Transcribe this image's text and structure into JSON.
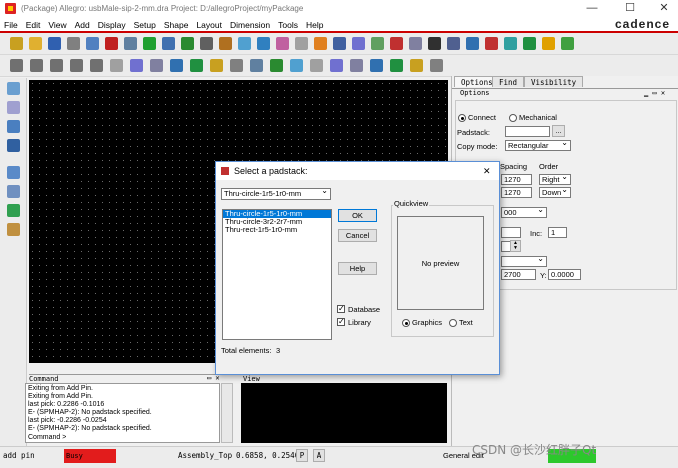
{
  "window": {
    "title": "(Package) Allegro: usbMale-sip-2-mm.dra  Project: D:/allegroProject/myPackage",
    "minimize": "—",
    "maximize": "☐",
    "close": "✕"
  },
  "brand": "cadence",
  "menu": [
    "File",
    "Edit",
    "View",
    "Add",
    "Display",
    "Setup",
    "Shape",
    "Layout",
    "Dimension",
    "Tools",
    "Help"
  ],
  "toolbar_colors": [
    "#c8a020",
    "#e0b030",
    "#3060b0",
    "#808080",
    "#5080c0",
    "#c02020",
    "#6080a0",
    "#20a030",
    "#4070b0",
    "#2a8a30",
    "#606060",
    "#b07020",
    "#50a0d0",
    "#3080c0",
    "#c060a0",
    "#a0a0a0",
    "#e08020",
    "#4060a0",
    "#7070d0",
    "#60a060",
    "#c03030",
    "#8080a0",
    "#303030",
    "#506090",
    "#3070b0",
    "#c03030",
    "#30a0a0",
    "#209040",
    "#e0a000",
    "#40a040"
  ],
  "options_panel": {
    "tabs": [
      "Options",
      "Find",
      "Visibility"
    ],
    "header": "Options",
    "connect_label": "Connect",
    "mechanical_label": "Mechanical",
    "padstack_label": "Padstack:",
    "padstack_value": "",
    "browse_button": "...",
    "copy_mode_label": "Copy mode:",
    "copy_mode_value": "Rectangular",
    "spacing_label": "Spacing",
    "order_label": "Order",
    "spacing_x": "1270",
    "spacing_y": "1270",
    "order_x": "Right",
    "order_y": "Down",
    "rotation_value": "000",
    "inc_label": "Inc:",
    "inc_value": "1",
    "x_value": "2700",
    "y_label": "Y:",
    "y_value": "0.0000"
  },
  "command_panel": {
    "header": "Command",
    "lines": [
      "Exiting from Add Pin.",
      "Exiting from Add Pin.",
      "last pick:  0.2286 -0.1016",
      "E- (SPMHAP-2): No padstack specified.",
      "last pick:  -0.2286 -0.0254",
      "E- (SPMHAP-2): No padstack specified.",
      "Command >"
    ]
  },
  "view_panel": {
    "header": "View"
  },
  "status_bar": {
    "command": "add pin",
    "state": "Busy",
    "subclass": "Assembly_Top",
    "coords": "0.6858, 0.2540",
    "p_button": "P",
    "a_button": "A",
    "mode": "General edit",
    "watermark": "CSDN @长沙红胖子Qt"
  },
  "dialog": {
    "title": "Select a padstack:",
    "close": "✕",
    "filter_value": "Thru-circle-1r5-1r0-mm",
    "items": [
      "Thru-circle-1r5-1r0-mm",
      "Thru-circle-3r2-2r7-mm",
      "Thru-rect-1r5-1r0-mm"
    ],
    "selected_index": 0,
    "ok": "OK",
    "cancel": "Cancel",
    "help": "Help",
    "database_label": "Database",
    "library_label": "Library",
    "quickview_label": "Quickview",
    "no_preview": "No preview",
    "graphics_label": "Graphics",
    "text_label": "Text",
    "total_label": "Total elements:",
    "total_value": "3"
  }
}
